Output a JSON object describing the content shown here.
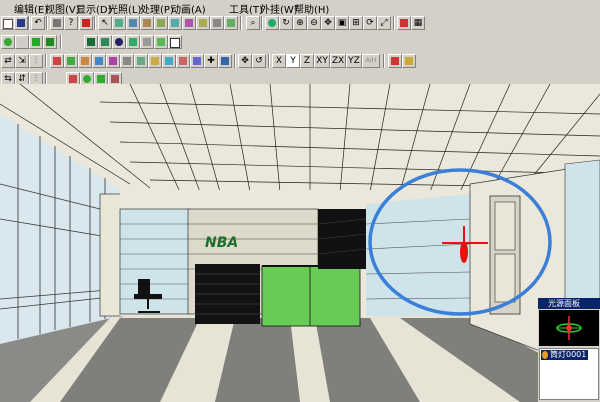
{
  "menu": [
    "编辑(E)",
    "视图(V)",
    "显示(D)",
    "光照(L)",
    "处理(P)",
    "动画(A)",
    "工具(T)",
    "外挂(W)",
    "帮助(H)"
  ],
  "toolbar": {
    "axis_buttons": [
      "X",
      "Y",
      "Z",
      "XY",
      "ZX",
      "YZ",
      "A/H"
    ]
  },
  "scene": {
    "logo_text": "NBA",
    "colors": {
      "highlight_circle": "#3a7fd8",
      "light_marker": "#e8120c",
      "glass_green": "#66cc55",
      "wall": "#ebe7da",
      "glass_blue": "#cfe3ea"
    }
  },
  "light_panel": {
    "title": "光源面板",
    "selected_item": "筒灯0001"
  }
}
